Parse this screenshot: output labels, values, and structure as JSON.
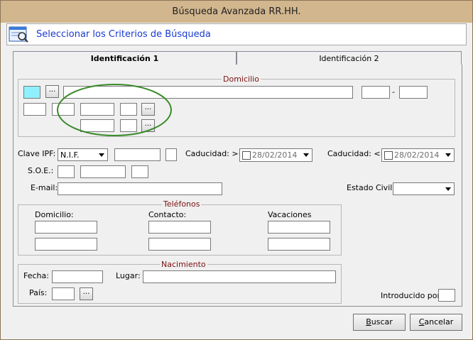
{
  "window": {
    "title": "Búsqueda Avanzada RR.HH."
  },
  "header": {
    "label": "Seleccionar los Criterios de Búsqueda",
    "icon": "search-criteria-icon"
  },
  "tabs": [
    {
      "label": "Identificación 1",
      "active": true
    },
    {
      "label": "Identificación 2",
      "active": false
    }
  ],
  "domicilio": {
    "title": "Domicilio",
    "dash": "-",
    "browse": "..."
  },
  "clave": {
    "label": "Clave IPF:",
    "doc_type": "N.I.F.",
    "caducidad_from_label": "Caducidad: >=",
    "caducidad_from_value": "28/02/2014",
    "caducidad_to_label": "Caducidad: <=",
    "caducidad_to_value": "28/02/2014"
  },
  "soe": {
    "label": "S.O.E.:"
  },
  "email": {
    "label": "E-mail:"
  },
  "estado_civil": {
    "label": "Estado Civil:"
  },
  "telefonos": {
    "title": "Teléfonos",
    "col1": "Domicilio:",
    "col2": "Contacto:",
    "col3": "Vacaciones"
  },
  "nacimiento": {
    "title": "Nacimiento",
    "fecha": "Fecha:",
    "lugar": "Lugar:",
    "pais": "País:",
    "browse": "..."
  },
  "introducido": {
    "label": "Introducido por:"
  },
  "buttons": {
    "buscar_u": "B",
    "buscar_rest": "uscar",
    "cancelar_u": "C",
    "cancelar_rest": "ancelar"
  },
  "colors": {
    "titlebar": "#d2b68e",
    "header_text": "#1a3ad0",
    "group_title": "#7a1010",
    "highlight_ellipse": "#3a8a2a",
    "selected_field": "#8ff0ff"
  }
}
